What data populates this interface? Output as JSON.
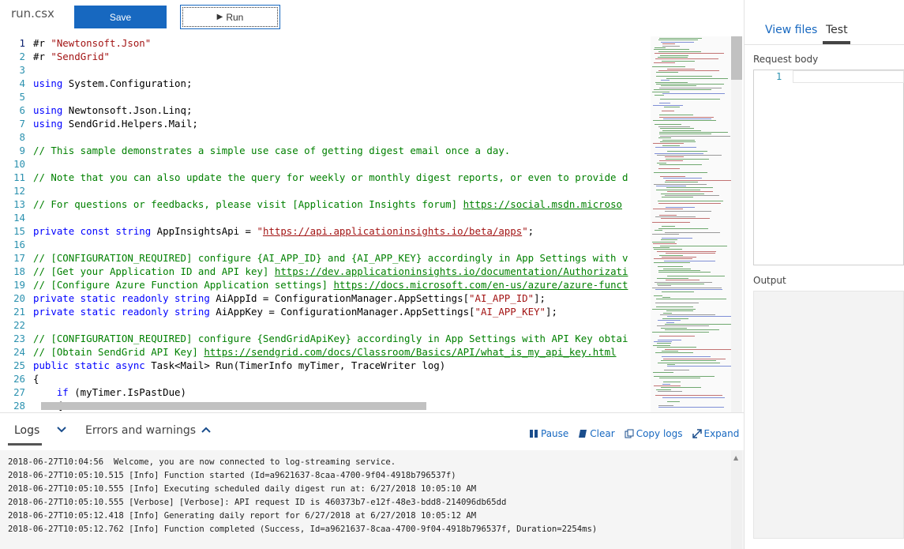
{
  "toolbar": {
    "filename": "run.csx",
    "save_label": "Save",
    "run_label": "Run"
  },
  "editor": {
    "lines": [
      {
        "n": "1",
        "tokens": [
          [
            "plain",
            "#r "
          ],
          [
            "str",
            "\"Newtonsoft.Json\""
          ]
        ]
      },
      {
        "n": "2",
        "tokens": [
          [
            "plain",
            "#r "
          ],
          [
            "str",
            "\"SendGrid\""
          ]
        ]
      },
      {
        "n": "3",
        "tokens": []
      },
      {
        "n": "4",
        "tokens": [
          [
            "kw",
            "using"
          ],
          [
            "plain",
            " System.Configuration;"
          ]
        ]
      },
      {
        "n": "5",
        "tokens": []
      },
      {
        "n": "6",
        "tokens": [
          [
            "kw",
            "using"
          ],
          [
            "plain",
            " Newtonsoft.Json.Linq;"
          ]
        ]
      },
      {
        "n": "7",
        "tokens": [
          [
            "kw",
            "using"
          ],
          [
            "plain",
            " SendGrid.Helpers.Mail;"
          ]
        ]
      },
      {
        "n": "8",
        "tokens": []
      },
      {
        "n": "9",
        "tokens": [
          [
            "cm",
            "// This sample demonstrates a simple use case of getting digest email once a day."
          ]
        ]
      },
      {
        "n": "10",
        "tokens": []
      },
      {
        "n": "11",
        "tokens": [
          [
            "cm",
            "// Note that you can also update the query for weekly or monthly digest reports, or even to provide d"
          ]
        ]
      },
      {
        "n": "12",
        "tokens": []
      },
      {
        "n": "13",
        "tokens": [
          [
            "cm",
            "// For questions or feedbacks, please visit [Application Insights forum] "
          ],
          [
            "link",
            "https://social.msdn.microso"
          ]
        ]
      },
      {
        "n": "14",
        "tokens": []
      },
      {
        "n": "15",
        "tokens": [
          [
            "kw",
            "private const string"
          ],
          [
            "plain",
            " AppInsightsApi = "
          ],
          [
            "str",
            "\""
          ],
          [
            "strlink",
            "https://api.applicationinsights.io/beta/apps"
          ],
          [
            "str",
            "\""
          ],
          [
            "plain",
            ";"
          ]
        ]
      },
      {
        "n": "16",
        "tokens": []
      },
      {
        "n": "17",
        "tokens": [
          [
            "cm",
            "// [CONFIGURATION_REQUIRED] configure {AI_APP_ID} and {AI_APP_KEY} accordingly in App Settings with v"
          ]
        ]
      },
      {
        "n": "18",
        "tokens": [
          [
            "cm",
            "// [Get your Application ID and API key] "
          ],
          [
            "link",
            "https://dev.applicationinsights.io/documentation/Authorizati"
          ]
        ]
      },
      {
        "n": "19",
        "tokens": [
          [
            "cm",
            "// [Configure Azure Function Application settings] "
          ],
          [
            "link",
            "https://docs.microsoft.com/en-us/azure/azure-funct"
          ]
        ]
      },
      {
        "n": "20",
        "tokens": [
          [
            "kw",
            "private static readonly string"
          ],
          [
            "plain",
            " AiAppId = ConfigurationManager.AppSettings["
          ],
          [
            "str",
            "\"AI_APP_ID\""
          ],
          [
            "plain",
            "];"
          ]
        ]
      },
      {
        "n": "21",
        "tokens": [
          [
            "kw",
            "private static readonly string"
          ],
          [
            "plain",
            " AiAppKey = ConfigurationManager.AppSettings["
          ],
          [
            "str",
            "\"AI_APP_KEY\""
          ],
          [
            "plain",
            "];"
          ]
        ]
      },
      {
        "n": "22",
        "tokens": []
      },
      {
        "n": "23",
        "tokens": [
          [
            "cm",
            "// [CONFIGURATION_REQUIRED] configure {SendGridApiKey} accordingly in App Settings with API Key obtai"
          ]
        ]
      },
      {
        "n": "24",
        "tokens": [
          [
            "cm",
            "// [Obtain SendGrid API Key] "
          ],
          [
            "link",
            "https://sendgrid.com/docs/Classroom/Basics/API/what_is_my_api_key.html"
          ]
        ]
      },
      {
        "n": "25",
        "tokens": [
          [
            "kw",
            "public static async"
          ],
          [
            "plain",
            " Task<Mail> Run(TimerInfo myTimer, TraceWriter log)"
          ]
        ]
      },
      {
        "n": "26",
        "tokens": [
          [
            "plain",
            "{"
          ]
        ]
      },
      {
        "n": "27",
        "tokens": [
          [
            "plain",
            "    "
          ],
          [
            "kw",
            "if"
          ],
          [
            "plain",
            " (myTimer.IsPastDue)"
          ]
        ]
      },
      {
        "n": "28",
        "tokens": [
          [
            "plain",
            "    {"
          ]
        ]
      }
    ]
  },
  "logs": {
    "tab_logs": "Logs",
    "tab_errors": "Errors and warnings",
    "pause": "Pause",
    "clear": "Clear",
    "copy": "Copy logs",
    "expand": "Expand",
    "entries": [
      "2018-06-27T10:04:56  Welcome, you are now connected to log-streaming service.",
      "2018-06-27T10:05:10.515 [Info] Function started (Id=a9621637-8caa-4700-9f04-4918b796537f)",
      "2018-06-27T10:05:10.555 [Info] Executing scheduled daily digest run at: 6/27/2018 10:05:10 AM",
      "2018-06-27T10:05:10.555 [Verbose] [Verbose]: API request ID is 460373b7-e12f-48e3-bdd8-214096db65dd",
      "2018-06-27T10:05:12.418 [Info] Generating daily report for 6/27/2018 at 6/27/2018 10:05:12 AM",
      "2018-06-27T10:05:12.762 [Info] Function completed (Success, Id=a9621637-8caa-4700-9f04-4918b796537f, Duration=2254ms)"
    ]
  },
  "right_panel": {
    "tab_view_files": "View files",
    "tab_test": "Test",
    "request_body_label": "Request body",
    "request_line_number": "1",
    "output_label": "Output"
  },
  "colors": {
    "accent": "#1768c0",
    "keyword": "#0000ff",
    "string": "#a31515",
    "comment": "#008000",
    "line_number": "#2b91af"
  }
}
